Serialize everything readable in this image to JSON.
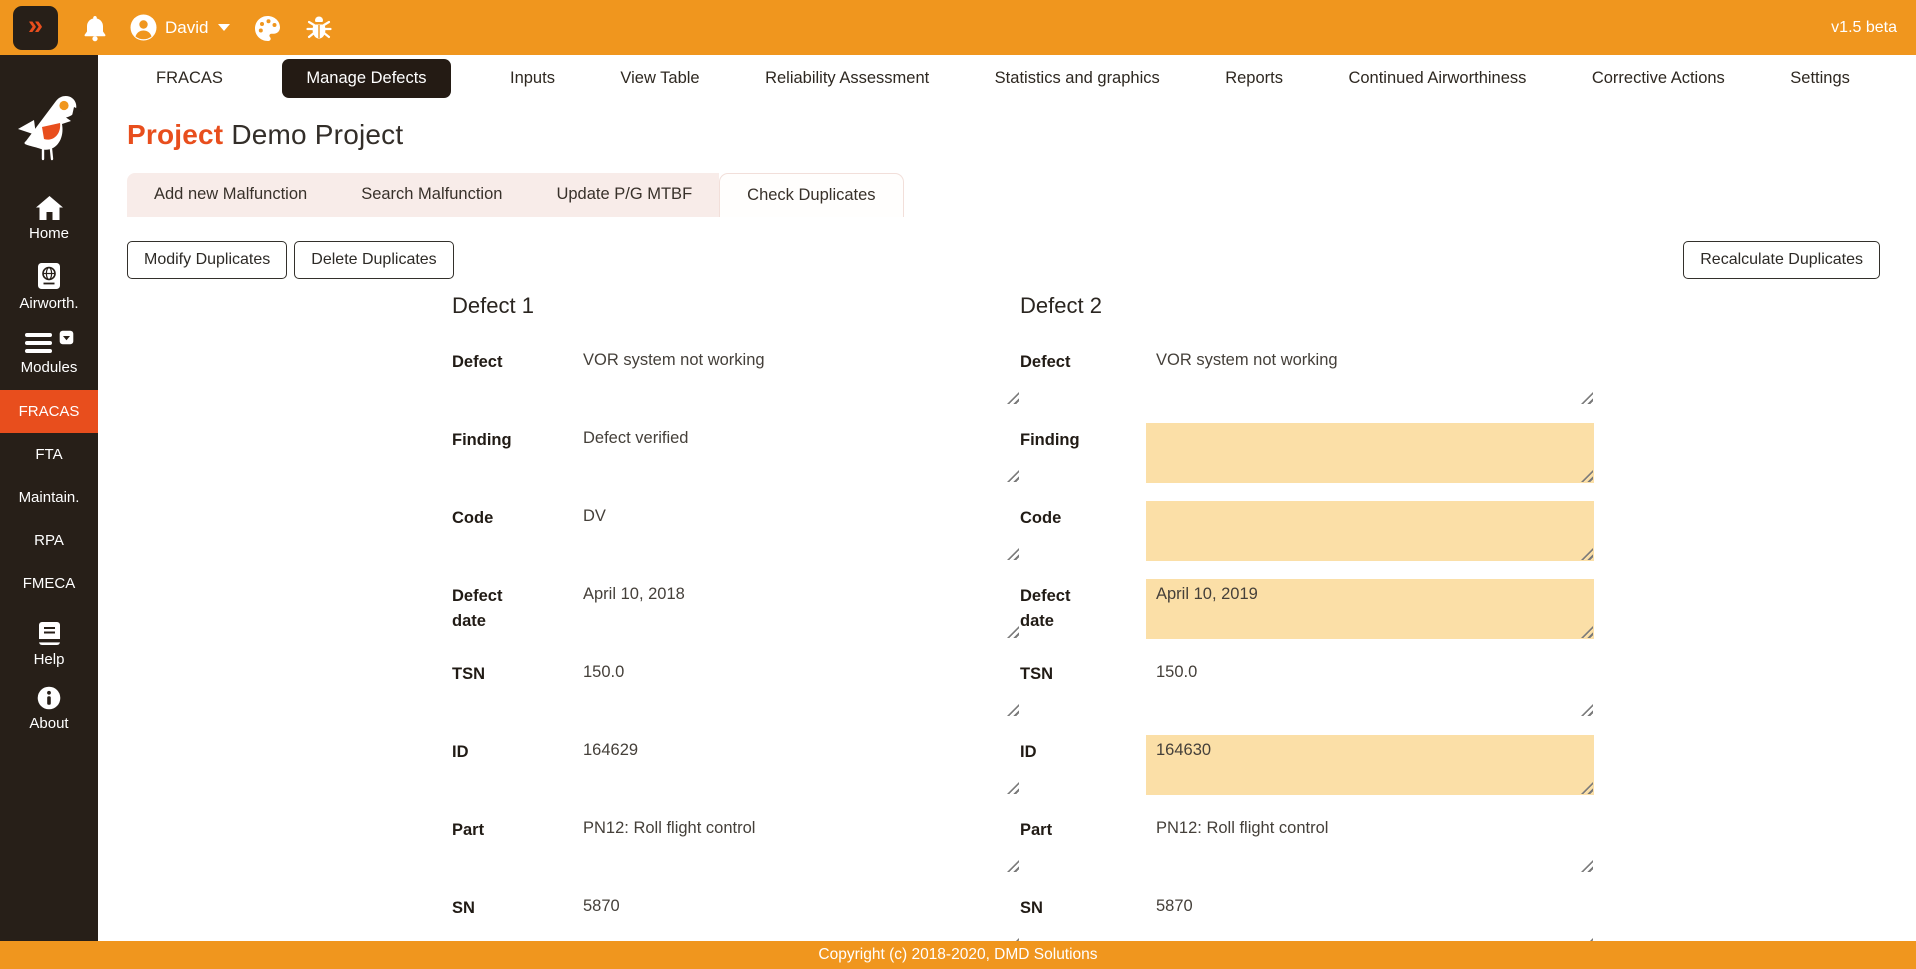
{
  "topbar": {
    "collapse_label": "»",
    "user": "David",
    "version": "v1.5 beta"
  },
  "nav": {
    "items": [
      {
        "label": "FRACAS",
        "active": false
      },
      {
        "label": "Manage Defects",
        "active": true
      },
      {
        "label": "Inputs",
        "active": false
      },
      {
        "label": "View Table",
        "active": false
      },
      {
        "label": "Reliability Assessment",
        "active": false
      },
      {
        "label": "Statistics and graphics",
        "active": false
      },
      {
        "label": "Reports",
        "active": false
      },
      {
        "label": "Continued Airworthiness",
        "active": false
      },
      {
        "label": "Corrective Actions",
        "active": false
      },
      {
        "label": "Settings",
        "active": false
      }
    ]
  },
  "sidebar": {
    "home": "Home",
    "airworth": "Airworth.",
    "modules": "Modules",
    "fracas": "FRACAS",
    "fta": "FTA",
    "maintain": "Maintain.",
    "rpa": "RPA",
    "fmeca": "FMECA",
    "help": "Help",
    "about": "About"
  },
  "page": {
    "title_prefix": "Project",
    "title_value": "Demo Project"
  },
  "tabs": {
    "items": [
      {
        "label": "Add new Malfunction",
        "active": false
      },
      {
        "label": "Search Malfunction",
        "active": false
      },
      {
        "label": "Update P/G MTBF",
        "active": false
      },
      {
        "label": "Check Duplicates",
        "active": true
      }
    ]
  },
  "toolbar": {
    "modify": "Modify Duplicates",
    "delete": "Delete Duplicates",
    "recalculate": "Recalculate Duplicates"
  },
  "comparison": {
    "columns": [
      {
        "title": "Defect 1",
        "fields": [
          {
            "label": "Defect",
            "value": "VOR system not working",
            "highlighted": false
          },
          {
            "label": "Finding",
            "value": "Defect verified",
            "highlighted": false
          },
          {
            "label": "Code",
            "value": "DV",
            "highlighted": false
          },
          {
            "label": "Defect date",
            "value": "April 10, 2018",
            "highlighted": false
          },
          {
            "label": "TSN",
            "value": "150.0",
            "highlighted": false
          },
          {
            "label": "ID",
            "value": "164629",
            "highlighted": false
          },
          {
            "label": "Part",
            "value": "PN12: Roll flight control",
            "highlighted": false
          },
          {
            "label": "SN",
            "value": "5870",
            "highlighted": false
          }
        ]
      },
      {
        "title": "Defect 2",
        "fields": [
          {
            "label": "Defect",
            "value": "VOR system not working",
            "highlighted": false
          },
          {
            "label": "Finding",
            "value": "",
            "highlighted": true
          },
          {
            "label": "Code",
            "value": "",
            "highlighted": true
          },
          {
            "label": "Defect date",
            "value": "April 10, 2019",
            "highlighted": true
          },
          {
            "label": "TSN",
            "value": "150.0",
            "highlighted": false
          },
          {
            "label": "ID",
            "value": "164630",
            "highlighted": true
          },
          {
            "label": "Part",
            "value": "PN12: Roll flight control",
            "highlighted": false
          },
          {
            "label": "SN",
            "value": "5870",
            "highlighted": false
          }
        ]
      }
    ]
  },
  "footer": {
    "copyright": "Copyright (c) 2018-2020, DMD Solutions"
  },
  "colors": {
    "accent": "#E84E1D",
    "orange": "#F0961E",
    "highlight": "#FBDFA7",
    "sidebar_dark": "#271F18",
    "tab_inactive": "#F8ECE9"
  }
}
